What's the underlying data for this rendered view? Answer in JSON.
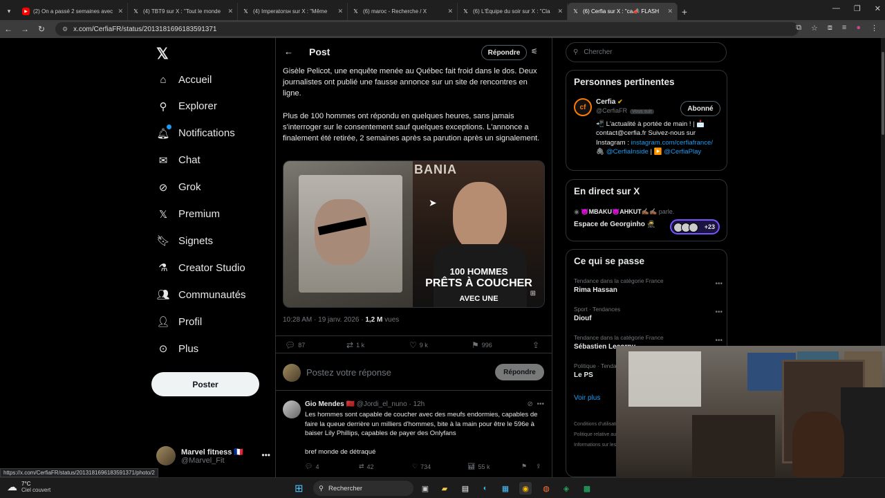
{
  "browser": {
    "tabs": [
      {
        "label": "(2) On a passé 2 semaines avec",
        "favicon": "youtube-icon",
        "color": "#ff0000",
        "active": false
      },
      {
        "label": "(4) TBT9 sur X : \"Tout le monde",
        "favicon": "x-icon",
        "color": "#ffffff",
        "active": false
      },
      {
        "label": "(4) Imperatorsн sur X : \"Même",
        "favicon": "x-icon",
        "color": "#ffffff",
        "active": false
      },
      {
        "label": "(6) maroc - Recherche / X",
        "favicon": "x-icon",
        "color": "#ffffff",
        "active": false
      },
      {
        "label": "(6) L'Équipe du soir sur X : \"Cla",
        "favicon": "x-icon",
        "color": "#ffffff",
        "active": false
      },
      {
        "label": "(6) Cerfia sur X : \"ca📣 FLASH",
        "favicon": "x-icon",
        "color": "#ffffff",
        "active": true
      }
    ],
    "url": "x.com/CerfiaFR/status/2013181696183591371",
    "status_url": "https://x.com/CerfiaFR/status/2013181696183591371/photo/2"
  },
  "sidebar": {
    "items": [
      {
        "label": "Accueil",
        "icon": "home-icon",
        "glyph": "⌂"
      },
      {
        "label": "Explorer",
        "icon": "search-icon",
        "glyph": "⚲"
      },
      {
        "label": "Notifications",
        "icon": "bell-icon",
        "glyph": "🔔︎"
      },
      {
        "label": "Chat",
        "icon": "mail-icon",
        "glyph": "✉"
      },
      {
        "label": "Grok",
        "icon": "grok-icon",
        "glyph": "⊘"
      },
      {
        "label": "Premium",
        "icon": "x-premium-icon",
        "glyph": "𝕏"
      },
      {
        "label": "Signets",
        "icon": "bookmark-icon",
        "glyph": "🔖︎"
      },
      {
        "label": "Creator Studio",
        "icon": "flask-icon",
        "glyph": "⚗"
      },
      {
        "label": "Communautés",
        "icon": "people-icon",
        "glyph": "👥︎"
      },
      {
        "label": "Profil",
        "icon": "person-icon",
        "glyph": "👤︎"
      },
      {
        "label": "Plus",
        "icon": "more-circle-icon",
        "glyph": "⊙"
      }
    ],
    "post_button": "Poster",
    "account": {
      "name": "Marvel fitness 🇫🇷",
      "handle": "@Marvel_Fit"
    }
  },
  "header": {
    "title": "Post",
    "reply_button": "Répondre"
  },
  "post": {
    "paragraph1": "Gisèle Pelicot, une enquête menée au Québec fait froid dans le dos. Deux journalistes ont publié une fausse annonce sur un site de rencontres en ligne.",
    "paragraph2": "Plus de 100 hommes ont répondu en quelques heures,  sans jamais s'interroger sur le consentement sauf quelques exceptions. L'annonce a finalement été retirée, 2 semaines après sa parution après un signalement.",
    "media": {
      "banner": "BANIA",
      "line1": "100 HOMMES",
      "line2": "PRÊTS À COUCHER",
      "line3": "AVEC UNE"
    },
    "time": "10:28 AM · 19 janv. 2026 ·",
    "views": "1,2 M",
    "views_label": "vues",
    "stats": {
      "replies": "87",
      "reposts": "1 k",
      "likes": "9 k",
      "bookmarks": "996"
    }
  },
  "reply_box": {
    "placeholder": "Postez votre réponse",
    "button": "Répondre"
  },
  "reply": {
    "name": "Gio Mendes 🇲🇦",
    "handle": "@Jordi_el_nuno · 12h",
    "text": "Les hommes sont capable de coucher avec des meufs endormies, capables de faire la queue derrière un milliers d'hommes, bite à la main pour être le 596e à baiser Lily Phillips, capables de payer des Onlyfans",
    "text2": "bref monde de détraqué",
    "stats": {
      "replies": "4",
      "reposts": "42",
      "likes": "734",
      "views": "55 k"
    }
  },
  "right": {
    "search_placeholder": "Chercher",
    "relevant": {
      "title": "Personnes pertinentes",
      "name": "Cerfia",
      "handle": "@CerfiaFR",
      "follows_you": "Vous suit",
      "follow_button": "Abonné",
      "bio": "📲 L'actualité à portée de main ! | 📩 contact@cerfia.fr Suivez-nous sur Instagram :",
      "link1": "instagram.com/cerfiafrance/",
      "link2": "@CerfiaInside",
      "link3": "@CerfiaPlay"
    },
    "live": {
      "title": "En direct sur X",
      "host": "😈MBAKU😈AHKUT✍🏾✍🏾",
      "host_suffix": "parle.",
      "space": "Espace de Georginho 🥷",
      "count": "+23"
    },
    "trends": {
      "title": "Ce qui se passe",
      "items": [
        {
          "category": "Tendance dans la catégorie France",
          "name": "Rima Hassan"
        },
        {
          "category": "Sport · Tendances",
          "name": "Diouf"
        },
        {
          "category": "Tendance dans la catégorie France",
          "name": "Sébastien Lecornu"
        },
        {
          "category": "Politique · Tendances",
          "name": "Le PS"
        }
      ],
      "more": "Voir plus"
    },
    "footer": [
      "Conditions d'utilisation",
      "Politique relative aux cookies",
      "Informations sur les publicités"
    ]
  },
  "taskbar": {
    "temp": "7°C",
    "weather": "Ciel couvert",
    "search": "Rechercher"
  }
}
